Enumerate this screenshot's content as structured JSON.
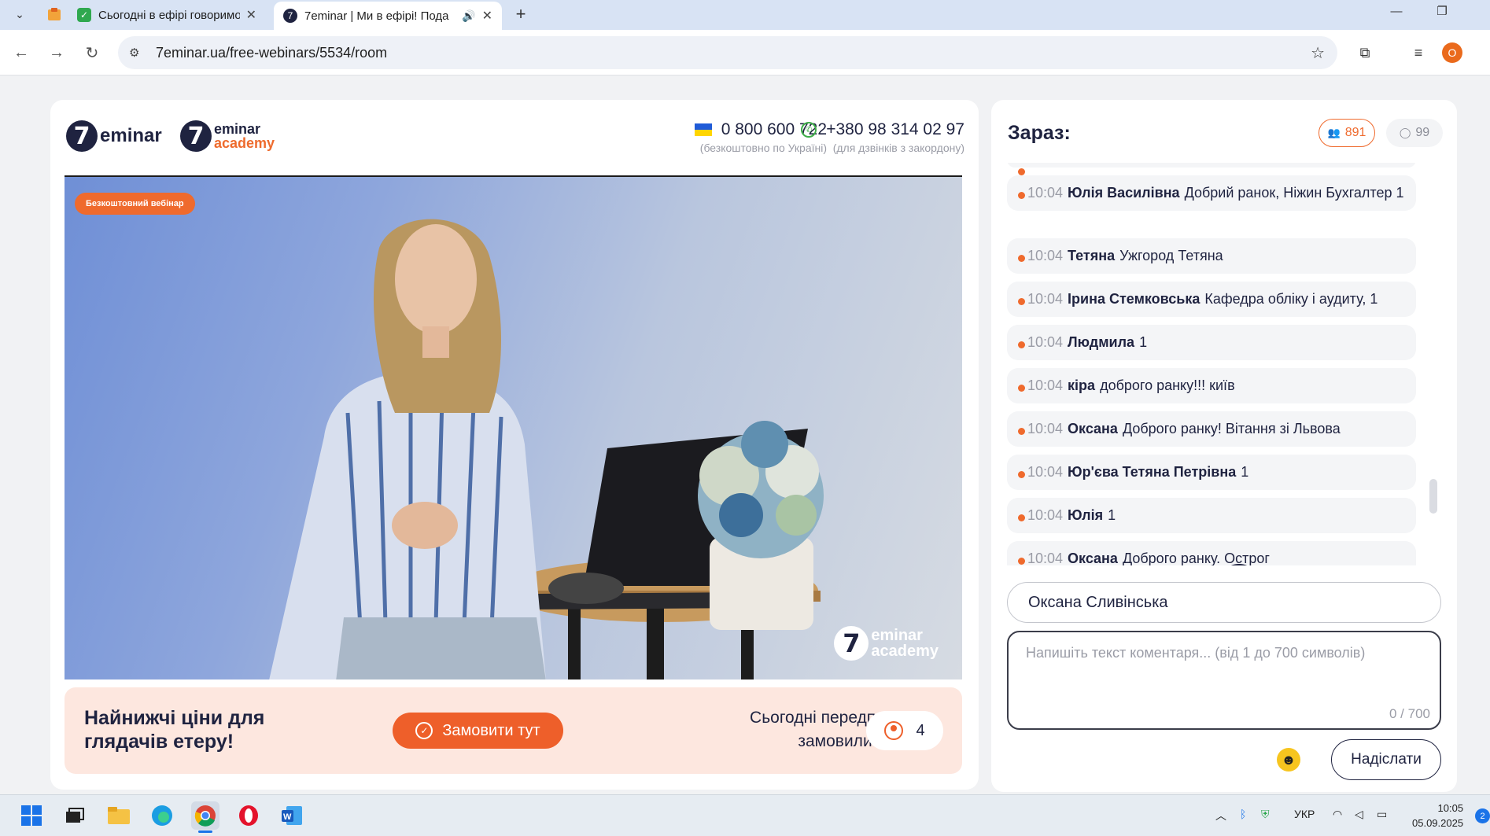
{
  "browser": {
    "tabs": [
      {
        "title": "Сьогодні в ефірі говоримо",
        "active": false
      },
      {
        "title": "7eminar | Ми в ефірі! Пода",
        "active": true
      }
    ],
    "url": "7eminar.ua/free-webinars/5534/room",
    "profile_initial": "O"
  },
  "header": {
    "logo1_word": "eminar",
    "logo2_top": "eminar",
    "logo2_bottom": "academy",
    "logo_digit": "7",
    "phone1": {
      "number": "0 800 600 722",
      "note": "(безкоштовно по Україні)"
    },
    "phone2": {
      "number": "+380 98 314 02 97",
      "note": "(для дзвінків з закордону)"
    }
  },
  "video": {
    "badge": "Безкоштовний вебінар",
    "watermark_top": "eminar",
    "watermark_bottom": "academy"
  },
  "promo": {
    "headline": "Найнижчі ціни для глядачів етеру!",
    "order_button": "Замовити тут",
    "already_text": "Сьогодні передплату замовили вже:",
    "count": "4"
  },
  "chat": {
    "title": "Зараз:",
    "viewers": "891",
    "comments": "99",
    "messages": [
      {
        "time": "10:04",
        "name": "Юлія Василівна",
        "text": "Добрий ранок, Ніжин Бухгалтер 1"
      },
      {
        "time": "10:04",
        "name": "Тетяна",
        "text": "Ужгород Тетяна"
      },
      {
        "time": "10:04",
        "name": "Ірина Стемковська",
        "text": "Кафедра обліку і аудиту, 1"
      },
      {
        "time": "10:04",
        "name": "Людмила",
        "text": "1"
      },
      {
        "time": "10:04",
        "name": "кіра",
        "text": "доброго ранку!!! київ"
      },
      {
        "time": "10:04",
        "name": "Оксана",
        "text": "Доброго ранку! Вітання зі Львова"
      },
      {
        "time": "10:04",
        "name": "Юр'єва Тетяна Петрівна",
        "text": "1"
      },
      {
        "time": "10:04",
        "name": "Юлія",
        "text": "1"
      },
      {
        "time": "10:04",
        "name": "Оксана",
        "text": "Доброго ранку. Острог"
      }
    ],
    "name_value": "Оксана Сливінська",
    "comment_placeholder": "Напишіть текст коментаря... (від 1 до 700 символів)",
    "counter": "0 / 700",
    "send_button": "Надіслати"
  },
  "taskbar": {
    "lang": "УКР",
    "time": "10:05",
    "date": "05.09.2025",
    "notifications": "2"
  },
  "colors": {
    "accent": "#ee5f2a",
    "navy": "#1f2340",
    "promo_bg": "#fde7df"
  }
}
